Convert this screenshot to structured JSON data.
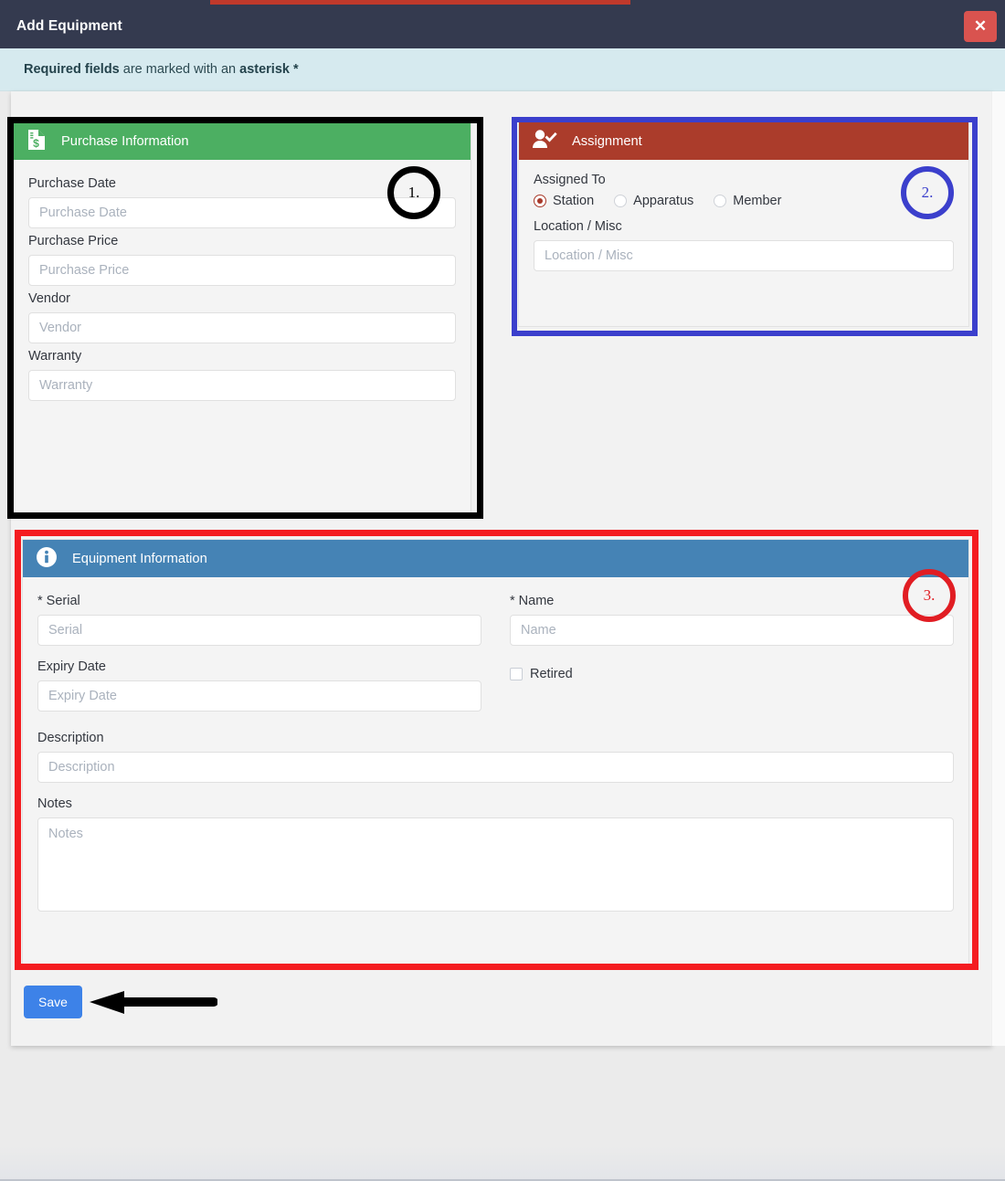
{
  "window": {
    "title": "Add Equipment",
    "close_label": "✕",
    "progress_color": "#c0392b",
    "header_color": "#343a4f"
  },
  "alert": {
    "strong_1": "Required fields",
    "middle": " are marked with an ",
    "strong_2": "asterisk *",
    "background": "#d6eaef"
  },
  "panels": {
    "purchase": {
      "title": "Purchase Information",
      "icon": "invoice-dollar-icon",
      "header_color": "#4caf62",
      "fields": [
        {
          "label": "Purchase Date",
          "placeholder": "Purchase Date",
          "value": ""
        },
        {
          "label": "Purchase Price",
          "placeholder": "Purchase Price",
          "value": ""
        },
        {
          "label": "Vendor",
          "placeholder": "Vendor",
          "value": ""
        },
        {
          "label": "Warranty",
          "placeholder": "Warranty",
          "value": ""
        }
      ]
    },
    "assignment": {
      "title": "Assignment",
      "icon": "user-check-icon",
      "header_color": "#ab3c2b",
      "assigned_to_label": "Assigned To",
      "radios": [
        {
          "label": "Station",
          "selected": true
        },
        {
          "label": "Apparatus",
          "selected": false
        },
        {
          "label": "Member",
          "selected": false
        }
      ],
      "location_label": "Location / Misc",
      "location_placeholder": "Location / Misc",
      "location_value": ""
    },
    "equipment": {
      "title": "Equipment Information",
      "icon": "info-circle-icon",
      "header_color": "#4583b5",
      "serial_label": "* Serial",
      "serial_placeholder": "Serial",
      "serial_value": "",
      "name_label": "* Name",
      "name_placeholder": "Name",
      "name_value": "",
      "expiry_label": "Expiry Date",
      "expiry_placeholder": "Expiry Date",
      "expiry_value": "",
      "retired_label": "Retired",
      "retired_checked": false,
      "description_label": "Description",
      "description_placeholder": "Description",
      "description_value": "",
      "notes_label": "Notes",
      "notes_placeholder": "Notes",
      "notes_value": ""
    }
  },
  "footer": {
    "save_label": "Save"
  },
  "annotations": {
    "one": "1.",
    "two": "2.",
    "three": "3.",
    "color_one": "#000000",
    "color_two": "#3b3fcc",
    "color_three": "#e11d23"
  }
}
